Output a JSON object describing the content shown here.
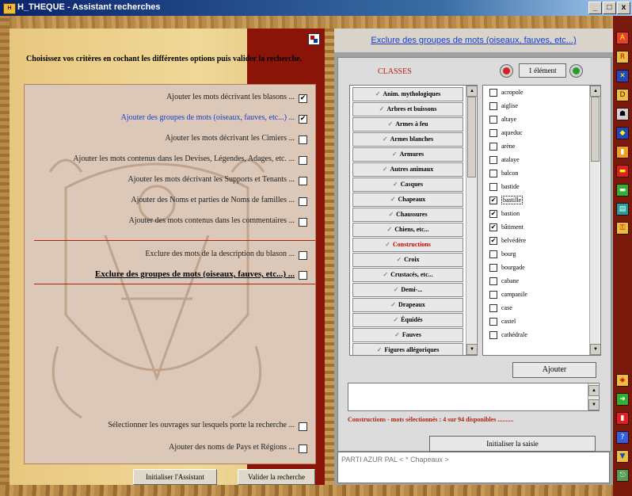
{
  "window": {
    "title": "H_THEQUE - Assistant recherches",
    "controls": [
      "_",
      "□",
      "x"
    ]
  },
  "left": {
    "instructions": "Choisissez vos critères en cochant les différentes options puis valider la recherche.",
    "options": [
      {
        "label": "Ajouter les mots décrivant les blasons ...",
        "checked": "✔"
      },
      {
        "label": "Ajouter des groupes de mots (oiseaux, fauves, etc...) ...",
        "checked": "✔"
      },
      {
        "label": "Ajouter les mots décrivant les Cimiers ...",
        "checked": ""
      },
      {
        "label": "Ajouter les mots contenus dans les Devises, Légendes, Adages, etc. ...",
        "checked": ""
      },
      {
        "label": "Ajouter les mots décrivant les Supports et Tenants ...",
        "checked": ""
      },
      {
        "label": "Ajouter des Noms et parties de Noms de familles ...",
        "checked": ""
      },
      {
        "label": "Ajouter des mots contenus dans les commentaires ...",
        "checked": ""
      },
      {
        "label": "Exclure des mots de la description du blason ...",
        "checked": ""
      },
      {
        "label": "Exclure des groupes de mots (oiseaux, fauves, etc...) ...",
        "checked": ""
      },
      {
        "label": "Sélectionner les ouvrages sur lesquels porte la recherche ...",
        "checked": ""
      },
      {
        "label": "Ajouter des noms de Pays et Régions ...",
        "checked": ""
      }
    ],
    "btn_init": "Initialiser l'Assistant",
    "btn_validate": "Valider la recherche"
  },
  "right": {
    "header": "Exclure des groupes de mots (oiseaux, fauves, etc...)",
    "classes_label": "CLASSES",
    "element_count": "1 élément",
    "classes": [
      "Anim. mythologiques",
      "Arbres et buissons",
      "Armes à feu",
      "Armes blanches",
      "Armures",
      "Autres animaux",
      "Casques",
      "Chapeaux",
      "Chaussures",
      "Chiens, etc...",
      "Constructions",
      "Croix",
      "Crustacés, etc...",
      "Demi-...",
      "Drapeaux",
      "Équidés",
      "Fauves",
      "Figures allégoriques"
    ],
    "active_class": "Constructions",
    "words": [
      {
        "label": "acropole",
        "checked": ""
      },
      {
        "label": "aiglise",
        "checked": ""
      },
      {
        "label": "altaye",
        "checked": ""
      },
      {
        "label": "aqueduc",
        "checked": ""
      },
      {
        "label": "arène",
        "checked": ""
      },
      {
        "label": "atalaye",
        "checked": ""
      },
      {
        "label": "balcon",
        "checked": ""
      },
      {
        "label": "bastide",
        "checked": ""
      },
      {
        "label": "bastille",
        "checked": "✔"
      },
      {
        "label": "bastion",
        "checked": "✔"
      },
      {
        "label": "bâtiment",
        "checked": "✔"
      },
      {
        "label": "belvédère",
        "checked": "✔"
      },
      {
        "label": "bourg",
        "checked": ""
      },
      {
        "label": "bourgade",
        "checked": ""
      },
      {
        "label": "cabane",
        "checked": ""
      },
      {
        "label": "campanile",
        "checked": ""
      },
      {
        "label": "case",
        "checked": ""
      },
      {
        "label": "castel",
        "checked": ""
      },
      {
        "label": "cathédrale",
        "checked": ""
      }
    ],
    "ajouter": "Ajouter",
    "status": "Constructions - mots sélectionnés : 4 sur 94 disponibles ..........",
    "init_saisie": "Initialiser la saisie",
    "query": "PARTI AZUR PAL < * Chapeaux >"
  },
  "toolbar": {
    "icons": [
      "shield-a-icon",
      "shield-r-icon",
      "shield-x-icon",
      "shield-d-icon",
      "helmet-icon",
      "shield-blue-icon",
      "shield-orange-icon",
      "shield-red-icon",
      "shield-green-icon",
      "clipboard-icon",
      "key-icon"
    ],
    "bottom_icons": [
      "shield-small-icon",
      "arrow-right-icon",
      "bars-icon",
      "help-icon",
      "shield-yellow-icon",
      "exit-icon"
    ]
  }
}
